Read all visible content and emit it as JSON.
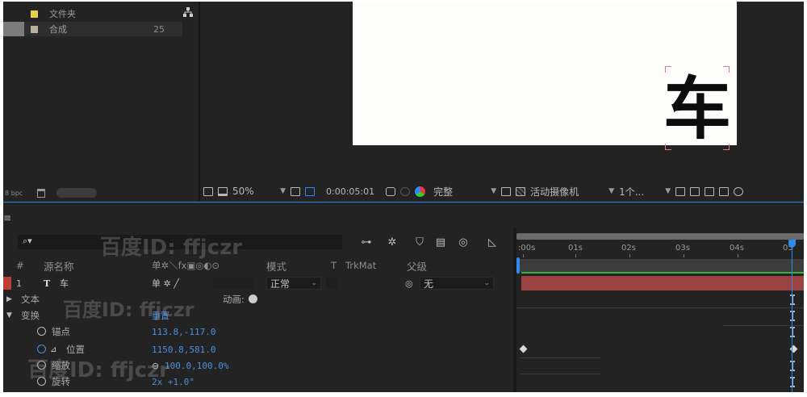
{
  "project": {
    "items": [
      {
        "name": "文件夹",
        "color": "#e6d24a",
        "count": ""
      },
      {
        "name": "合成",
        "color": "#b8b09a",
        "count": "25"
      }
    ],
    "bpc_label": "8 bpc"
  },
  "viewer": {
    "glyph": "车",
    "zoom": "50%",
    "timecode": "0:00:05:01",
    "resolution": "完整",
    "camera": "活动摄像机",
    "views": "1个..."
  },
  "timeline": {
    "search_placeholder": "",
    "headers": {
      "number": "#",
      "source_name": "源名称",
      "switches": "单✲＼fx▣◎◐⊙",
      "mode": "模式",
      "t": "T",
      "trkmat": "TrkMat",
      "parent": "父级"
    },
    "layer": {
      "number": "1",
      "type_icon": "T",
      "name": "车",
      "switches": "单 ✲ ╱",
      "mode": "正常",
      "parent": "无",
      "parent_icon": "◎"
    },
    "text_group": {
      "label": "文本",
      "animate_label": "动画:"
    },
    "transform": {
      "label": "变换",
      "reset": "重置",
      "properties": [
        {
          "name": "锚点",
          "value": "113.8,-117.0"
        },
        {
          "name": "位置",
          "value": "1150.8,581.0"
        },
        {
          "name": "缩放",
          "value": "100.0,100.0%"
        },
        {
          "name": "旋转",
          "value": "2x +1.0°"
        }
      ]
    },
    "ruler": [
      ":00s",
      "01s",
      "02s",
      "03s",
      "04s",
      "05"
    ]
  },
  "watermark": {
    "text": "百度ID: ffjczr"
  },
  "colors": {
    "accent_blue": "#2d8ceb",
    "layer_red": "#9b4343",
    "label_red": "#c23b3b",
    "value_blue": "#4b8fe0"
  }
}
